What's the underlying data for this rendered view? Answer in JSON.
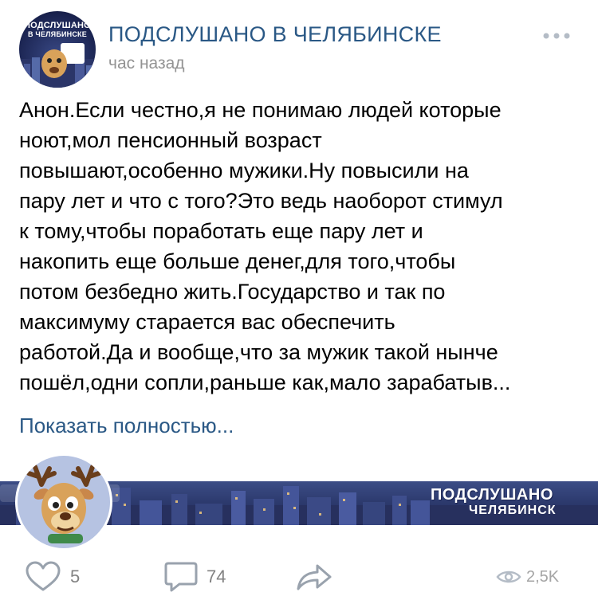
{
  "post": {
    "group_name": "ПОДСЛУШАНО В ЧЕЛЯБИНСКЕ",
    "time": "час назад",
    "avatar_text_line1": "ПОДСЛУШАНО",
    "avatar_text_line2": "В ЧЕЛЯБИНСКЕ",
    "text_lines": [
      "Анон.Если честно,я не понимаю людей которые",
      "ноют,мол пенсионный возраст",
      "повышают,особенно мужики.Ну повысили на",
      "пару лет и что с того?Это ведь наоборот стимул",
      "к тому,чтобы поработать еще пару лет и",
      "накопить еще больше денег,для того,чтобы",
      "потом безбедно жить.Государство и так по",
      "максимуму старается вас обеспечить",
      "работой.Да и вообще,что за мужик такой нынче",
      "пошёл,одни сопли,раньше как,мало зарабатыв..."
    ],
    "show_more": "Показать полностью..."
  },
  "banner": {
    "title_line1": "ПОДСЛУШАНО",
    "title_line2": "ЧЕЛЯБИНСК"
  },
  "actions": {
    "likes": "5",
    "comments": "74",
    "views": "2,5K"
  },
  "colors": {
    "link": "#2a5885",
    "meta": "#939393",
    "icon": "#99a2ad"
  }
}
